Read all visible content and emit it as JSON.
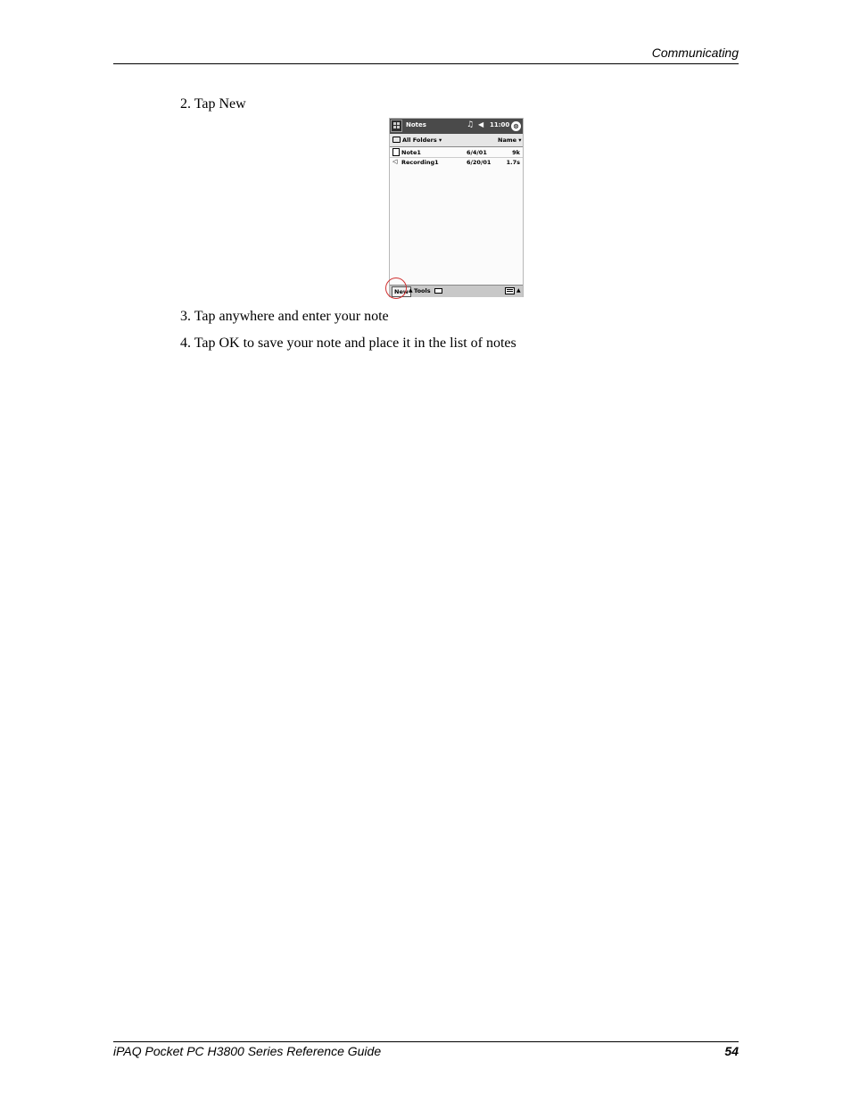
{
  "header": {
    "title": "Communicating"
  },
  "steps": [
    {
      "number": "2.",
      "text": "Tap New"
    },
    {
      "number": "3.",
      "text": "Tap anywhere and enter your note"
    },
    {
      "number": "4.",
      "text": "Tap OK to save your note and place it in the list of notes"
    }
  ],
  "screenshot": {
    "app_title": "Notes",
    "time": "11:00",
    "close_glyph": "⊗",
    "folder_filter": "All Folders ▾",
    "sort_by": "Name ▾",
    "files": [
      {
        "icon": "document-icon",
        "name": "Note1",
        "date": "6/4/01",
        "size": "9k"
      },
      {
        "icon": "speaker-icon",
        "name": "Recording1",
        "date": "6/20/01",
        "size": "1.7s"
      }
    ],
    "menu": {
      "new_label": "New",
      "tools_label": "Tools"
    },
    "highlight_color": "#d03030"
  },
  "footer": {
    "title": "iPAQ Pocket PC H3800 Series Reference Guide",
    "page_number": "54"
  }
}
